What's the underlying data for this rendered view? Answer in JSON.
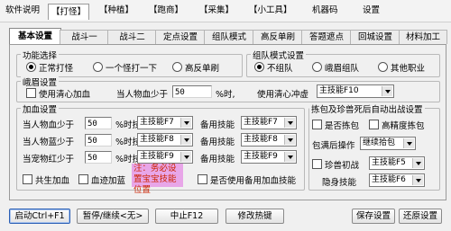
{
  "menubar": {
    "items": [
      {
        "label": "软件说明",
        "active": false
      },
      {
        "label": "【打怪】",
        "active": true
      },
      {
        "label": "【种植】",
        "active": false
      },
      {
        "label": "【跑商】",
        "active": false
      },
      {
        "label": "【采集】",
        "active": false
      },
      {
        "label": "【小工具】",
        "active": false
      },
      {
        "label": "机器码",
        "active": false
      },
      {
        "label": "设置",
        "active": false
      }
    ]
  },
  "tabs": [
    {
      "label": "基本设置",
      "active": true
    },
    {
      "label": "战斗一",
      "active": false
    },
    {
      "label": "战斗二",
      "active": false
    },
    {
      "label": "定点设置",
      "active": false
    },
    {
      "label": "组队模式",
      "active": false
    },
    {
      "label": "高反单刷",
      "active": false
    },
    {
      "label": "答题遮点",
      "active": false
    },
    {
      "label": "回城设置",
      "active": false
    },
    {
      "label": "材料加工",
      "active": false
    }
  ],
  "function_select": {
    "title": "功能选择",
    "options": [
      {
        "label": "正常打怪",
        "selected": true
      },
      {
        "label": "一个怪打一下",
        "selected": false
      },
      {
        "label": "高反单刷",
        "selected": false
      }
    ]
  },
  "team_mode": {
    "title": "组队模式设置",
    "options": [
      {
        "label": "不组队",
        "selected": true
      },
      {
        "label": "峨眉组队",
        "selected": false
      },
      {
        "label": "其他职业",
        "selected": false
      }
    ]
  },
  "emei": {
    "title": "峨眉设置",
    "use_heal_label": "使用清心加血",
    "use_heal_checked": false,
    "hp_below_label": "当人物血少于",
    "hp_below_value": "50",
    "hp_unit": "%时,",
    "use_skill_label": "使用清心冲虚",
    "skill_value": "主技能F10"
  },
  "heal": {
    "title": "加血设置",
    "rows": [
      {
        "label": "当人物血少于",
        "value": "50",
        "unit": "%时技",
        "skill": "主技能F7",
        "backup_label": "备用技能",
        "backup": "主技能F7"
      },
      {
        "label": "当人物蓝少于",
        "value": "50",
        "unit": "%时技",
        "skill": "主技能F8",
        "backup_label": "备用技能",
        "backup": "主技能F8"
      },
      {
        "label": "当宠物红少于",
        "value": "50",
        "unit": "%时技",
        "skill": "主技能F9",
        "backup_label": "备用技能",
        "backup": "主技能F9"
      }
    ],
    "co_heal_label": "共生加血",
    "co_heal_checked": false,
    "blood_mana_label": "血迹加蓝",
    "blood_mana_checked": false,
    "note": "注：务必设置宝宝技能位置",
    "use_backup_label": "是否使用备用加血技能",
    "use_backup_checked": false
  },
  "pickup": {
    "title": "拣包及珍兽死后自动出战设置",
    "pick_label": "是否拣包",
    "pick_checked": false,
    "hq_pick_label": "高精度拣包",
    "hq_pick_checked": false,
    "full_label": "包满后操作",
    "full_value": "继续拾包",
    "pet_label": "珍兽初战",
    "pet_checked": false,
    "pet_skill": "主技能F5",
    "stealth_label": "隐身技能",
    "stealth_skill": "主技能F6"
  },
  "buttons": {
    "start": "启动Ctrl+F1",
    "pause": "暂停/继续<无>",
    "stop": "中止F12",
    "hotkey": "修改热键",
    "save": "保存设置",
    "restore": "还原设置"
  }
}
